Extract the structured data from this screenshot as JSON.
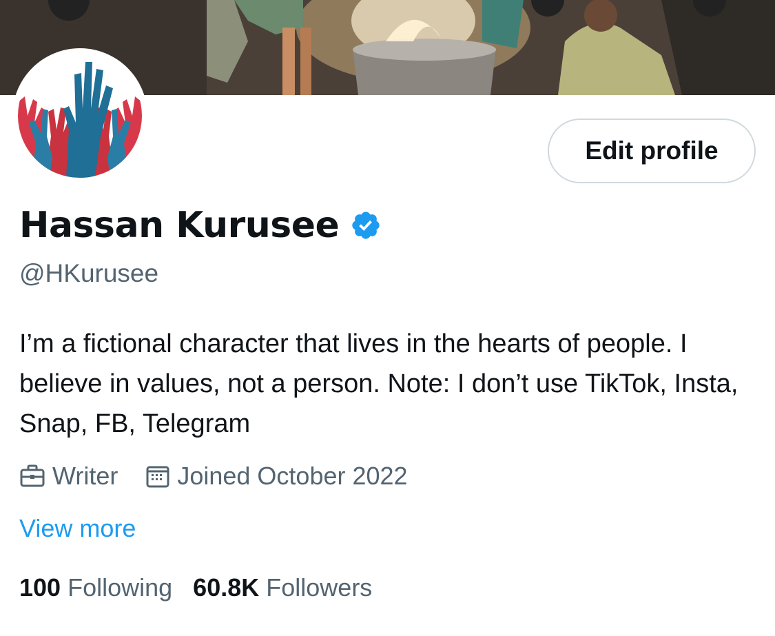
{
  "profile": {
    "display_name": "Hassan Kurusee",
    "handle": "@HKurusee",
    "verified_icon": "verified-badge-icon",
    "bio": "I’m a fictional character that lives in the hearts of people. I believe in values, not a person. Note: I don’t use TikTok, Insta, Snap, FB, Telegram",
    "profession": "Writer",
    "joined": "Joined October 2022",
    "view_more": "View more"
  },
  "actions": {
    "edit_profile_label": "Edit profile"
  },
  "stats": {
    "following_count": "100",
    "following_label": "Following",
    "followers_count": "60.8K",
    "followers_label": "Followers"
  },
  "colors": {
    "text_primary": "#0f1419",
    "text_secondary": "#536471",
    "link": "#1d9bf0",
    "verified": "#1d9bf0",
    "button_border": "#cfd9de"
  },
  "icons": {
    "profession": "briefcase-icon",
    "joined": "calendar-icon"
  }
}
